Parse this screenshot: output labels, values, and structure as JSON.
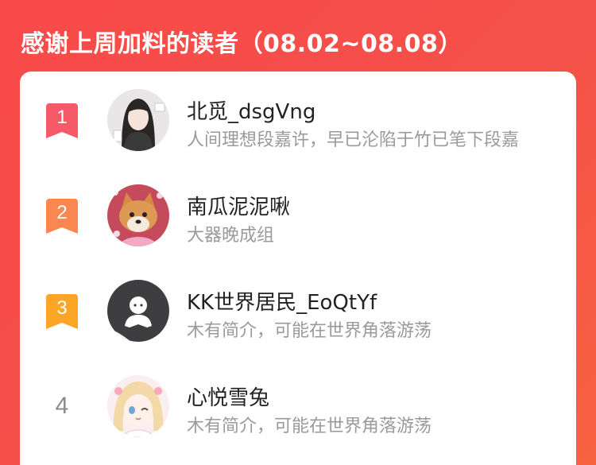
{
  "header": {
    "title": "感谢上周加料的读者（08.02~08.08）"
  },
  "colors": {
    "background_start": "#f84a4a",
    "background_end": "#f7623f",
    "rank1": "#f45a67",
    "rank2": "#fb8750",
    "rank3": "#fba626",
    "rank_plain": "#8a8a8a"
  },
  "readers": [
    {
      "rank": "1",
      "name": "北觅_dsgVng",
      "bio": "人间理想段嘉许，早已沦陷于竹已笔下段嘉",
      "avatar_icon": "girl-portrait-avatar"
    },
    {
      "rank": "2",
      "name": "南瓜泥泥啾",
      "bio": "大器晚成组",
      "avatar_icon": "shiba-dog-avatar"
    },
    {
      "rank": "3",
      "name": "KK世界居民_EoQtYf",
      "bio": "木有简介，可能在世界角落游荡",
      "avatar_icon": "default-user-avatar"
    },
    {
      "rank": "4",
      "name": "心悦雪兔",
      "bio": "木有简介，可能在世界角落游荡",
      "avatar_icon": "anime-girl-avatar"
    }
  ]
}
